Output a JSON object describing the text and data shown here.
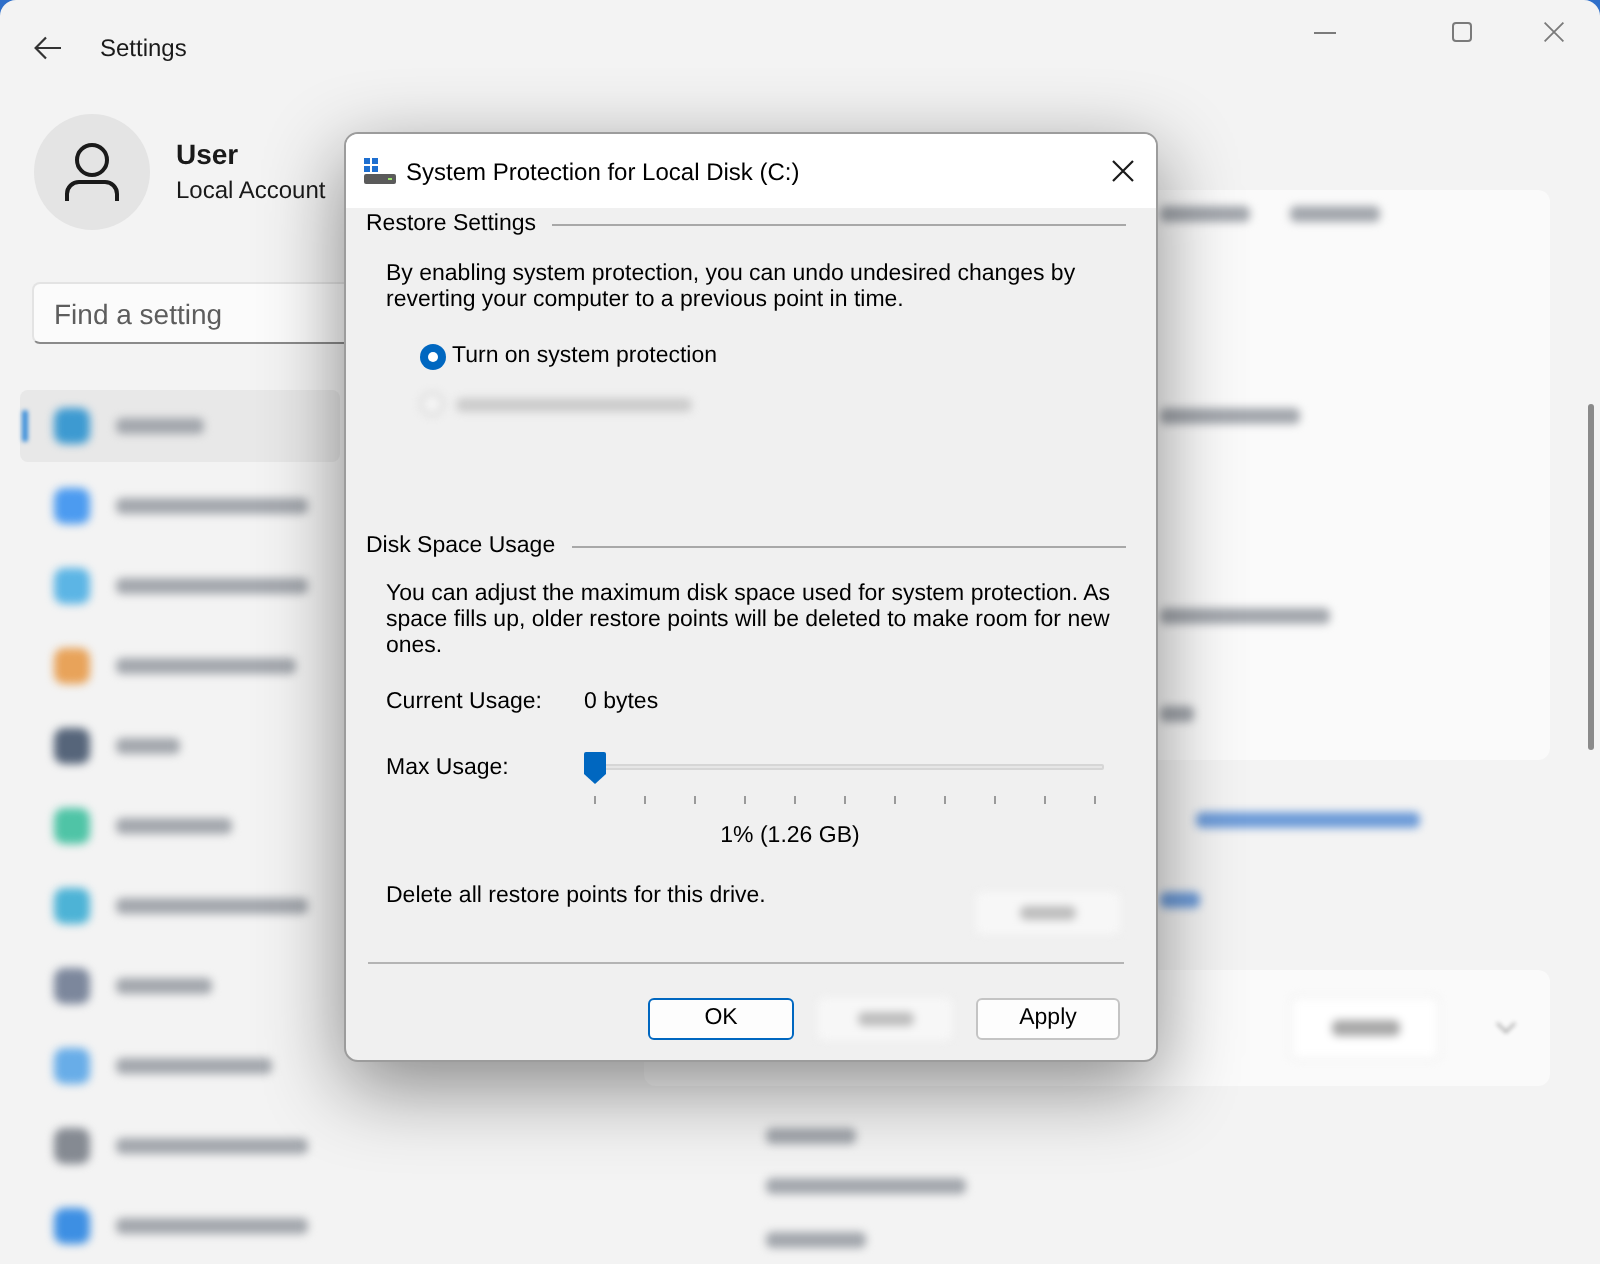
{
  "window": {
    "title": "Settings"
  },
  "account": {
    "name": "User",
    "type": "Local Account"
  },
  "search": {
    "placeholder": "Find a setting"
  },
  "nav_items": [
    {
      "selected": true,
      "color": "#3d9ad1"
    },
    {
      "selected": false,
      "color": "#4c9bf0"
    },
    {
      "selected": false,
      "color": "#5cb5e5"
    },
    {
      "selected": false,
      "color": "#e8a35a"
    },
    {
      "selected": false,
      "color": "#56657a"
    },
    {
      "selected": false,
      "color": "#4fc4a6"
    },
    {
      "selected": false,
      "color": "#4db3d6"
    },
    {
      "selected": false,
      "color": "#7c879c"
    },
    {
      "selected": false,
      "color": "#68ade8"
    },
    {
      "selected": false,
      "color": "#858a92"
    },
    {
      "selected": false,
      "color": "#3d8fe3"
    }
  ],
  "dialog": {
    "title": "System Protection for Local Disk (C:)",
    "restore_settings": {
      "heading": "Restore Settings",
      "description": "By enabling system protection, you can undo undesired changes by reverting your computer to a previous point in time.",
      "options": [
        {
          "kind": "option",
          "label": "Turn on system protection",
          "selected": true
        },
        {
          "kind": "blurred",
          "selected": false
        }
      ]
    },
    "disk_space": {
      "heading": "Disk Space Usage",
      "description": "You can adjust the maximum disk space used for system protection. As space fills up, older restore points will be deleted to make room for new ones.",
      "current_usage": {
        "label": "Current Usage:",
        "value": "0 bytes"
      },
      "max_usage": {
        "label": "Max Usage:",
        "level": 0,
        "reading": "1% (1.26 GB)"
      },
      "delete": {
        "text": "Delete all restore points for this drive.",
        "button": {
          "kind": "blurred"
        }
      }
    },
    "buttons": [
      {
        "kind": "default",
        "label": "OK"
      },
      {
        "kind": "blurred"
      },
      {
        "kind": "normal",
        "label": "Apply"
      }
    ]
  }
}
